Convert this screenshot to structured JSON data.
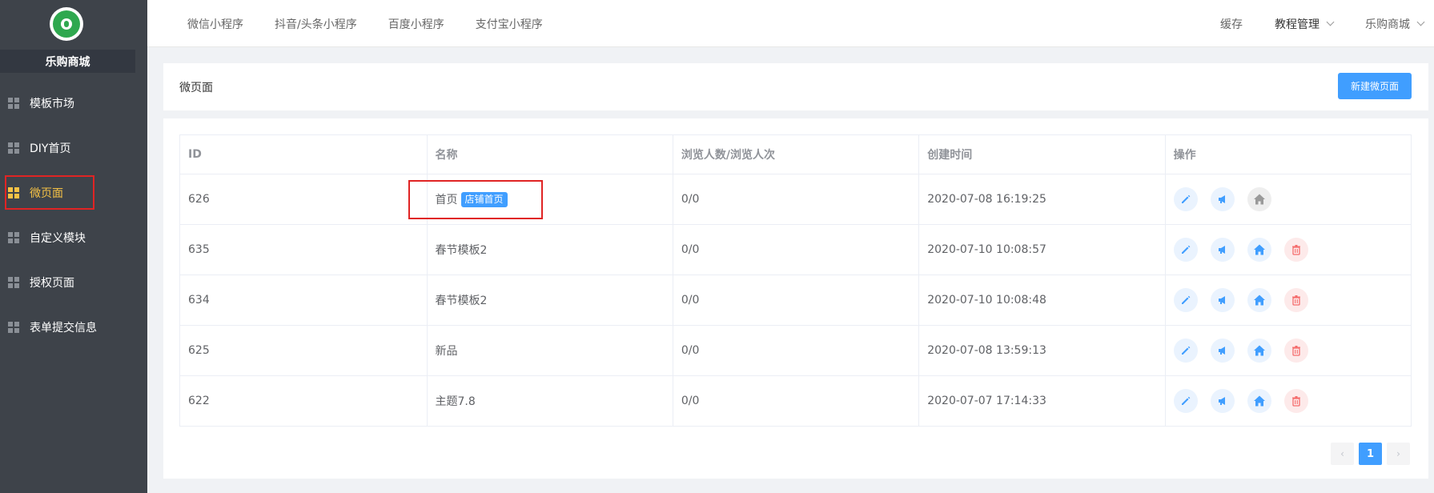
{
  "app": {
    "shop_name": "乐购商城"
  },
  "sidebar": {
    "items": [
      {
        "label": "模板市场",
        "active": false
      },
      {
        "label": "DIY首页",
        "active": false
      },
      {
        "label": "微页面",
        "active": true
      },
      {
        "label": "自定义模块",
        "active": false
      },
      {
        "label": "授权页面",
        "active": false
      },
      {
        "label": "表单提交信息",
        "active": false
      }
    ]
  },
  "topbar": {
    "tabs": [
      "微信小程序",
      "抖音/头条小程序",
      "百度小程序",
      "支付宝小程序"
    ],
    "cache": "缓存",
    "tutorial": "教程管理",
    "shop": "乐购商城"
  },
  "page": {
    "title": "微页面",
    "new_button": "新建微页面"
  },
  "table": {
    "headers": [
      "ID",
      "名称",
      "浏览人数/浏览人次",
      "创建时间",
      "操作"
    ],
    "rows": [
      {
        "id": "626",
        "name": "首页",
        "tag": "店铺首页",
        "views": "0/0",
        "created": "2020-07-08 16:19:25"
      },
      {
        "id": "635",
        "name": "春节模板2",
        "tag": "",
        "views": "0/0",
        "created": "2020-07-10 10:08:57"
      },
      {
        "id": "634",
        "name": "春节模板2",
        "tag": "",
        "views": "0/0",
        "created": "2020-07-10 10:08:48"
      },
      {
        "id": "625",
        "name": "新品",
        "tag": "",
        "views": "0/0",
        "created": "2020-07-08 13:59:13"
      },
      {
        "id": "622",
        "name": "主题7.8",
        "tag": "",
        "views": "0/0",
        "created": "2020-07-07 17:14:33"
      }
    ]
  },
  "pagination": {
    "prev": "‹",
    "current": "1",
    "next": "›"
  },
  "colors": {
    "primary": "#409eff",
    "sidebar": "#3e434a",
    "active": "#f5c245",
    "danger": "#f56c6c",
    "highlight": "#e02424"
  },
  "icons": {
    "edit": "pencil-icon",
    "promote": "megaphone-icon",
    "set_home": "house-icon",
    "delete": "trash-icon"
  }
}
